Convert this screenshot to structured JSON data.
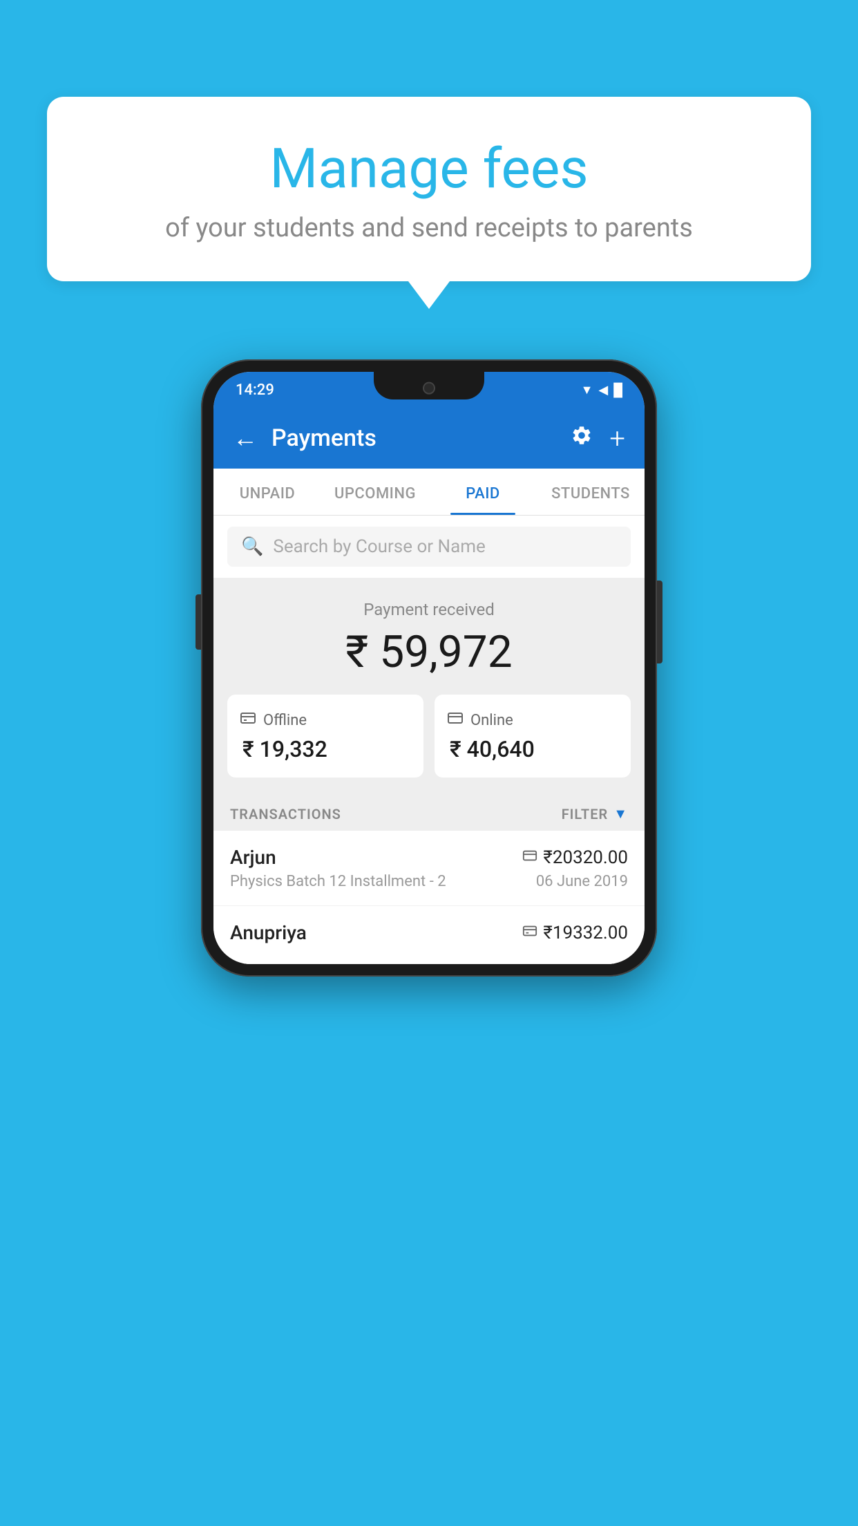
{
  "page": {
    "background_color": "#29B6E8"
  },
  "speech_bubble": {
    "title": "Manage fees",
    "subtitle": "of your students and send receipts to parents"
  },
  "phone": {
    "status_bar": {
      "time": "14:29",
      "icons": "▼◀█"
    },
    "app_bar": {
      "title": "Payments",
      "back_label": "←",
      "settings_label": "⚙",
      "add_label": "+"
    },
    "tabs": [
      {
        "label": "UNPAID",
        "active": false
      },
      {
        "label": "UPCOMING",
        "active": false
      },
      {
        "label": "PAID",
        "active": true
      },
      {
        "label": "STUDENTS",
        "active": false
      }
    ],
    "search": {
      "placeholder": "Search by Course or Name"
    },
    "summary": {
      "label": "Payment received",
      "amount": "₹ 59,972",
      "offline": {
        "icon": "💳",
        "label": "Offline",
        "amount": "₹ 19,332"
      },
      "online": {
        "icon": "🪙",
        "label": "Online",
        "amount": "₹ 40,640"
      }
    },
    "transactions": {
      "header_label": "TRANSACTIONS",
      "filter_label": "FILTER",
      "rows": [
        {
          "name": "Arjun",
          "detail": "Physics Batch 12 Installment - 2",
          "amount": "₹20320.00",
          "date": "06 June 2019",
          "type": "online"
        },
        {
          "name": "Anupriya",
          "detail": "",
          "amount": "₹19332.00",
          "date": "",
          "type": "offline"
        }
      ]
    }
  }
}
